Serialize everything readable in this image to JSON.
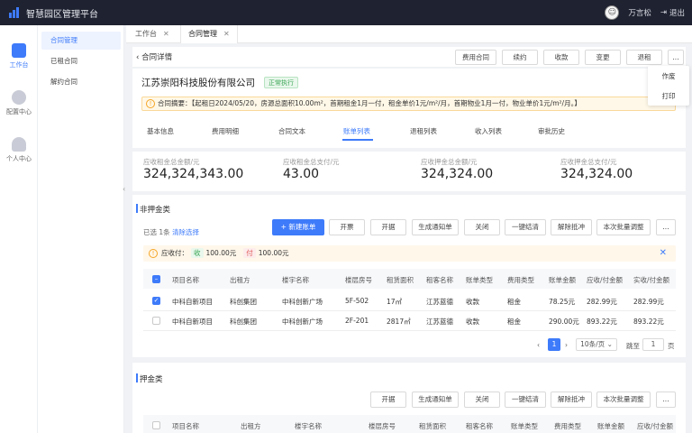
{
  "app": {
    "title": "智慧园区管理平台",
    "user": "万言松",
    "logout": "退出"
  },
  "nav1": [
    {
      "label": "工作台",
      "icon": "cube-icon"
    },
    {
      "label": "配置中心",
      "icon": "gear-icon"
    },
    {
      "label": "个人中心",
      "icon": "user-icon"
    }
  ],
  "nav2": [
    {
      "label": "合同管理",
      "active": true
    },
    {
      "label": "已租合同"
    },
    {
      "label": "解约合同"
    }
  ],
  "tabs": [
    {
      "label": "工作台"
    },
    {
      "label": "合同管理",
      "active": true
    }
  ],
  "toolbar": {
    "back": "合同详情",
    "buttons": [
      "费用合同",
      "续约",
      "收款",
      "变更",
      "退租",
      "..."
    ],
    "dropdown": [
      "作废",
      "打印"
    ]
  },
  "contract": {
    "company": "江苏崇阳科技股份有限公司",
    "status": "正常执行",
    "summary": "合同摘要：【起租日2024/05/20，房源总面积10.00m²，首期租金1月一付，租金单价1元/m²/月，首期物业1月一付，物业单价1元/m²/月。】"
  },
  "subtabs": [
    "基本信息",
    "费用明细",
    "合同文本",
    "账单列表",
    "退租列表",
    "收入列表",
    "审批历史"
  ],
  "stats": [
    {
      "label": "应收租金总金额/元",
      "value": "324,324,343.00"
    },
    {
      "label": "应收租金总支付/元",
      "value": "43.00"
    },
    {
      "label": "应收押金总金额/元",
      "value": "324,324.00"
    },
    {
      "label": "应收押金总支付/元",
      "value": "324,324.00"
    }
  ],
  "nondeposit": {
    "title": "非押金类",
    "sel_prefix": "已选",
    "sel_count": "1条",
    "clear": "清除选择",
    "buttons": [
      "+ 新建账单",
      "开票",
      "开据",
      "生成通知单",
      "关闭",
      "一键结清",
      "解除抵冲",
      "本次批量调整",
      "..."
    ],
    "alert": {
      "prefix": "应收付：",
      "income_tag": "收",
      "income": "100.00元",
      "expense_tag": "付",
      "expense": "100.00元",
      "close": "✕"
    },
    "columns": [
      "项目名称",
      "出租方",
      "楼宇名称",
      "楼层房号",
      "租赁面积",
      "租客名称",
      "账单类型",
      "费用类型",
      "账单金额",
      "应收/付金额",
      "实收/付金额"
    ],
    "rows": [
      {
        "checked": true,
        "cells": [
          "中科自新项目",
          "科创集团",
          "中科创新广场",
          "5F-502",
          "17㎡",
          "江苏蓝德",
          "收款",
          "租金",
          "78.25元",
          "282.99元",
          "282.99元"
        ]
      },
      {
        "checked": false,
        "cells": [
          "中科自新项目",
          "科创集团",
          "中科创新广场",
          "2F-201",
          "2817㎡",
          "江苏蓝德",
          "收款",
          "租金",
          "290.00元",
          "893.22元",
          "893.22元"
        ]
      }
    ],
    "pagination": {
      "page": "1",
      "size": "10条/页",
      "goto": "跳至",
      "page_input": "1",
      "page_unit": "页"
    }
  },
  "deposit": {
    "title": "押金类",
    "buttons": [
      "开据",
      "生成通知单",
      "关闭",
      "一键结清",
      "解除抵冲",
      "本次批量调整",
      "..."
    ],
    "columns": [
      "项目名称",
      "出租方",
      "楼宇名称",
      "楼层房号",
      "租赁面积",
      "租客名称",
      "账单类型",
      "费用类型",
      "账单金额",
      "应收/付金额"
    ]
  }
}
